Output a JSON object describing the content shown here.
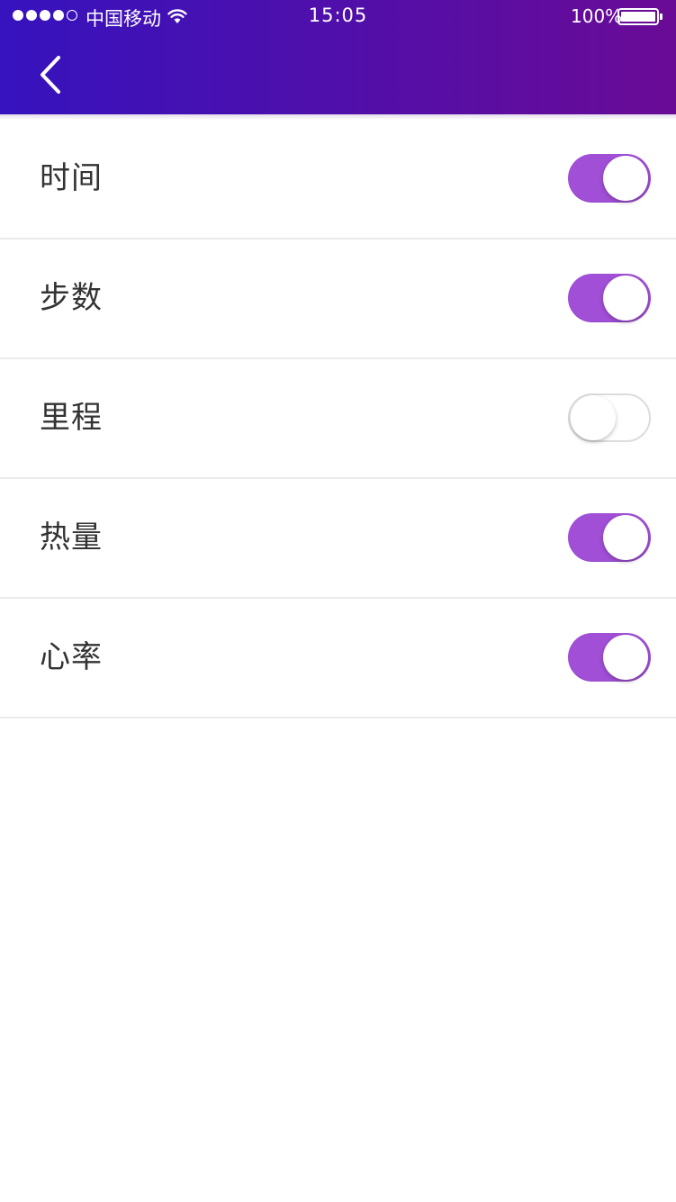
{
  "status_bar": {
    "signal_filled": 4,
    "signal_total": 5,
    "carrier": "中国移动",
    "time": "15:05",
    "battery": "100%",
    "battery_level": 1.0
  },
  "colors": {
    "header_gradient_start": "#3613be",
    "header_gradient_end": "#6a0b96",
    "toggle_on": "#a04fd6",
    "toggle_off_border": "#dcdcdc",
    "label_text": "#333333"
  },
  "header": {
    "back_icon": "chevron-left-icon"
  },
  "settings": [
    {
      "label": "时间",
      "enabled": true
    },
    {
      "label": "步数",
      "enabled": true
    },
    {
      "label": "里程",
      "enabled": false
    },
    {
      "label": "热量",
      "enabled": true
    },
    {
      "label": "心率",
      "enabled": true
    }
  ]
}
